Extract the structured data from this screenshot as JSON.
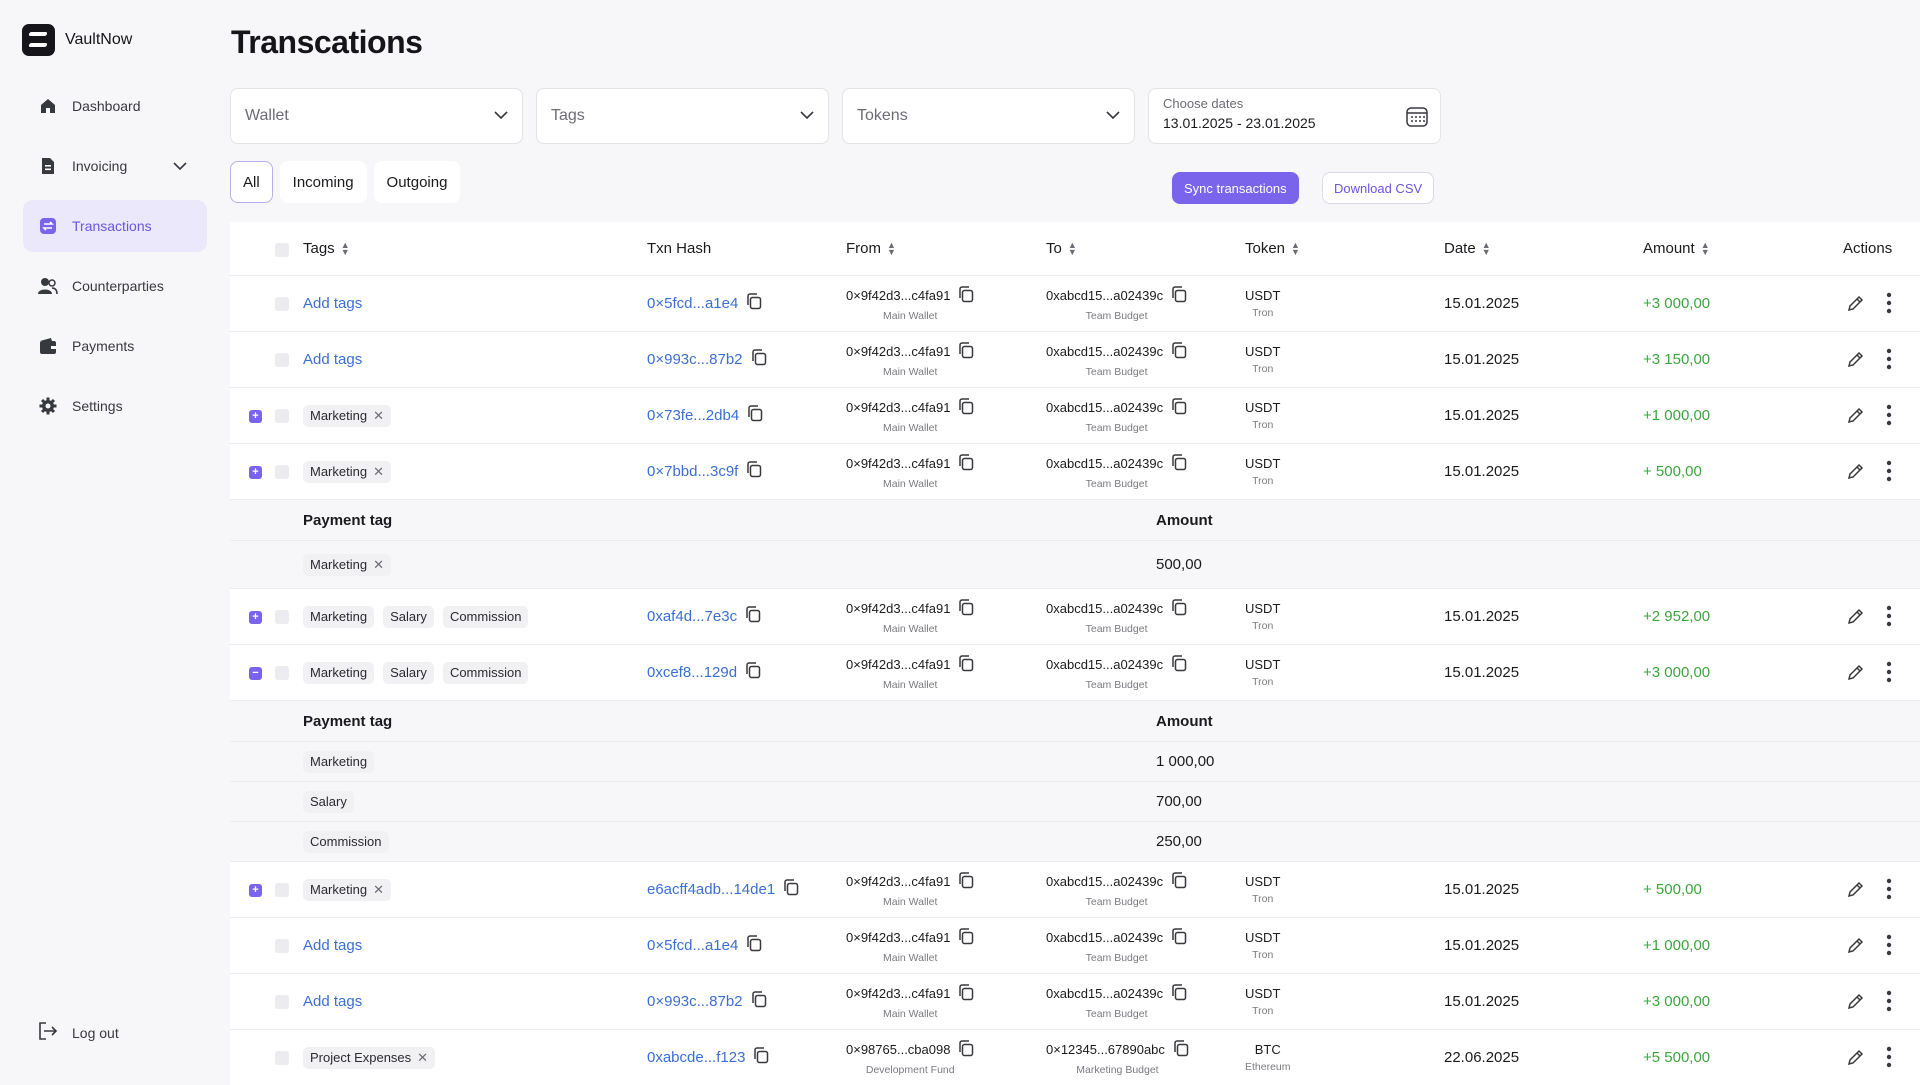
{
  "app": {
    "name": "VaultNow"
  },
  "sidebar": {
    "items": [
      {
        "label": "Dashboard",
        "icon": "home-icon"
      },
      {
        "label": "Invoicing",
        "icon": "document-icon",
        "has_chevron": true
      },
      {
        "label": "Transactions",
        "icon": "transfer-icon",
        "active": true
      },
      {
        "label": "Counterparties",
        "icon": "users-icon"
      },
      {
        "label": "Payments",
        "icon": "wallet-icon"
      },
      {
        "label": "Settings",
        "icon": "gear-icon"
      }
    ],
    "logout": "Log out"
  },
  "page": {
    "title": "Transcations"
  },
  "filters": {
    "wallet": "Wallet",
    "tags": "Tags",
    "tokens": "Tokens",
    "dates_label": "Choose dates",
    "dates_value": "13.01.2025 - 23.01.2025"
  },
  "segments": [
    "All",
    "Incoming",
    "Outgoing"
  ],
  "buttons": {
    "sync": "Sync transactions",
    "csv": "Download CSV"
  },
  "table": {
    "headers": {
      "tags": "Tags",
      "hash": "Txn Hash",
      "from": "From",
      "to": "To",
      "token": "Token",
      "date": "Date",
      "amount": "Amount",
      "actions": "Actions"
    },
    "add_tags": "Add tags",
    "sub_headers": {
      "tag": "Payment tag",
      "amount": "Amount"
    },
    "rows": [
      {
        "tags": [],
        "hash": "0×5fcd...a1e4",
        "from": "0×9f42d3...c4fa91",
        "from_sub": "Main Wallet",
        "to": "0xabcd15...a02439c",
        "to_sub": "Team Budget",
        "token": "USDT",
        "chain": "Tron",
        "date": "15.01.2025",
        "amount": "+3 000,00"
      },
      {
        "tags": [],
        "hash": "0×993c...87b2",
        "from": "0×9f42d3...c4fa91",
        "from_sub": "Main Wallet",
        "to": "0xabcd15...a02439c",
        "to_sub": "Team Budget",
        "token": "USDT",
        "chain": "Tron",
        "date": "15.01.2025",
        "amount": "+3 150,00"
      },
      {
        "tags": [
          "Marketing"
        ],
        "hash": "0×73fe...2db4",
        "from": "0×9f42d3...c4fa91",
        "from_sub": "Main Wallet",
        "to": "0xabcd15...a02439c",
        "to_sub": "Team Budget",
        "token": "USDT",
        "chain": "Tron",
        "date": "15.01.2025",
        "amount": "+1 000,00"
      },
      {
        "tags": [
          "Marketing"
        ],
        "hash": "0×7bbd...3c9f",
        "from": "0×9f42d3...c4fa91",
        "from_sub": "Main Wallet",
        "to": "0xabcd15...a02439c",
        "to_sub": "Team Budget",
        "token": "USDT",
        "chain": "Tron",
        "date": "15.01.2025",
        "amount": "+ 500,00"
      },
      {
        "tags": [
          "Marketing",
          "Salary",
          "Commission"
        ],
        "hash": "0xaf4d...7e3c",
        "from": "0×9f42d3...c4fa91",
        "from_sub": "Main Wallet",
        "to": "0xabcd15...a02439c",
        "to_sub": "Team Budget",
        "token": "USDT",
        "chain": "Tron",
        "date": "15.01.2025",
        "amount": "+2 952,00"
      },
      {
        "tags": [
          "Marketing",
          "Salary",
          "Commission"
        ],
        "hash": "0xcef8...129d",
        "from": "0×9f42d3...c4fa91",
        "from_sub": "Main Wallet",
        "to": "0xabcd15...a02439c",
        "to_sub": "Team Budget",
        "token": "USDT",
        "chain": "Tron",
        "date": "15.01.2025",
        "amount": "+3 000,00"
      },
      {
        "tags": [
          "Marketing"
        ],
        "hash": "e6acff4adb...14de1",
        "from": "0×9f42d3...c4fa91",
        "from_sub": "Main Wallet",
        "to": "0xabcd15...a02439c",
        "to_sub": "Team Budget",
        "token": "USDT",
        "chain": "Tron",
        "date": "15.01.2025",
        "amount": "+ 500,00"
      },
      {
        "tags": [],
        "hash": "0×5fcd...a1e4",
        "from": "0×9f42d3...c4fa91",
        "from_sub": "Main Wallet",
        "to": "0xabcd15...a02439c",
        "to_sub": "Team Budget",
        "token": "USDT",
        "chain": "Tron",
        "date": "15.01.2025",
        "amount": "+1 000,00"
      },
      {
        "tags": [],
        "hash": "0×993c...87b2",
        "from": "0×9f42d3...c4fa91",
        "from_sub": "Main Wallet",
        "to": "0xabcd15...a02439c",
        "to_sub": "Team Budget",
        "token": "USDT",
        "chain": "Tron",
        "date": "15.01.2025",
        "amount": "+3 000,00"
      },
      {
        "tags": [
          "Project Expenses"
        ],
        "hash": "0xabcde...f123",
        "from": "0×98765...cba098",
        "from_sub": "Development Fund",
        "to": "0×12345...67890abc",
        "to_sub": "Marketing Budget",
        "token": "BTC",
        "chain": "Ethereum",
        "date": "22.06.2025",
        "amount": "+5 500,00"
      }
    ],
    "split_a": [
      {
        "tag": "Marketing",
        "amount": "500,00"
      }
    ],
    "split_b": [
      {
        "tag": "Marketing",
        "amount": "1 000,00"
      },
      {
        "tag": "Salary",
        "amount": "700,00"
      },
      {
        "tag": "Commission",
        "amount": "250,00"
      }
    ]
  }
}
